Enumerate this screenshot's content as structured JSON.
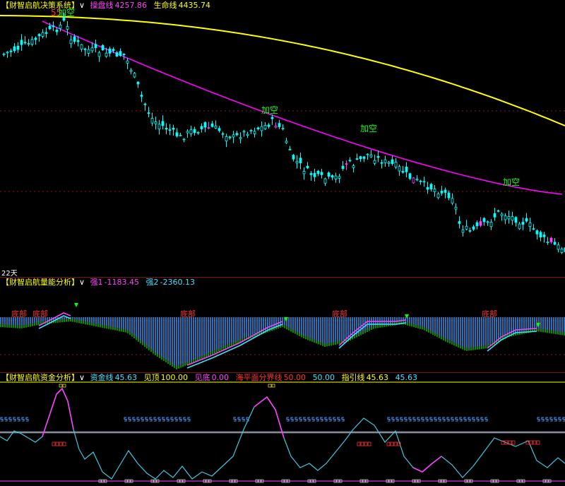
{
  "panels": {
    "main": {
      "title": "【财智启航决策系统】",
      "dropdown": "∨",
      "line1_label": "操盘线",
      "line1_value": "4257.86",
      "line2_label": "生命线",
      "line2_value": "4435.74",
      "period_label": "22天",
      "signal_texts": [
        "55",
        "加空",
        "加空",
        "加空",
        "加空"
      ]
    },
    "energy": {
      "title": "【财智启航量能分析】",
      "dropdown": "∨",
      "s1_label": "强1",
      "s1_value": "-1183.45",
      "s2_label": "强2",
      "s2_value": "-2360.13",
      "bottom_label": "底部"
    },
    "fund": {
      "title": "【财智启航资金分析】",
      "dropdown": "∨",
      "fund_line_label": "资金线",
      "fund_line_value": "45.63",
      "top_label": "见顶",
      "top_value": "100.00",
      "bottom_label": "见底",
      "bottom_value": "0.00",
      "sea_label": "海平面分界线",
      "sea_value": "50.00",
      "mid_value": "50.00",
      "guide_label": "指引线",
      "guide_value": "45.63",
      "guide_value2": "45.63"
    }
  },
  "colors": {
    "up_candle": "#00ffff",
    "down_candle": "#00ffff",
    "mark_candle": "#ff40ff",
    "yellow_ma": "#ffff00",
    "magenta_ma": "#ff00ff",
    "blue_bar": "#3aa0ff",
    "green_bar": "#00d000",
    "signal_green": "#00ff00",
    "signal_red": "#ff3030",
    "fund_line": "#40c8e0",
    "sea_line": "#40e0ff",
    "red_line": "#ff2020"
  },
  "chart_data": [
    {
      "type": "candlestick",
      "title": "【财智启航决策系统】",
      "series": [
        {
          "name": "操盘线",
          "last": 4257.86
        },
        {
          "name": "生命线",
          "last": 4435.74
        }
      ],
      "annotations": [
        "55",
        "加空",
        "加空",
        "加空",
        "加空",
        "22天"
      ]
    },
    {
      "type": "bar",
      "title": "【财智启航量能分析】",
      "series": [
        {
          "name": "强1",
          "last": -1183.45
        },
        {
          "name": "强2",
          "last": -2360.13
        }
      ],
      "annotations": [
        "底部",
        "底部",
        "底部",
        "底部",
        "底部"
      ]
    },
    {
      "type": "line",
      "title": "【财智启航资金分析】",
      "series": [
        {
          "name": "资金线",
          "last": 45.63
        },
        {
          "name": "见顶",
          "last": 100.0
        },
        {
          "name": "见底",
          "last": 0.0
        },
        {
          "name": "海平面分界线",
          "last": 50.0
        },
        {
          "name": "指引线",
          "last": 45.63
        }
      ],
      "ylim": [
        0,
        100
      ]
    }
  ]
}
